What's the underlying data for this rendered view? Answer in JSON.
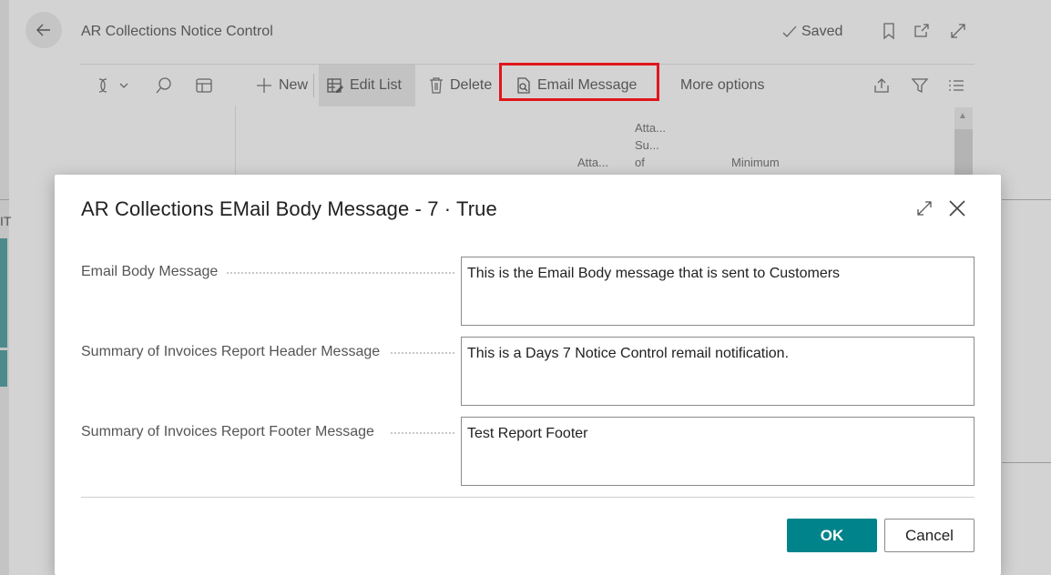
{
  "page": {
    "title": "AR Collections Notice Control",
    "saved_label": "Saved",
    "left_edge_letter": "IT"
  },
  "toolbar": {
    "new_label": "New",
    "edit_list_label": "Edit List",
    "delete_label": "Delete",
    "email_message_label": "Email Message",
    "more_options_label": "More options"
  },
  "grid": {
    "col1_header": "Atta...",
    "col2_header_lines": [
      "Atta...",
      "Su...",
      "of"
    ],
    "col3_header": "Minimum"
  },
  "modal": {
    "title": "AR Collections EMail Body Message - 7 · True",
    "fields": [
      {
        "label": "Email Body Message",
        "value": "This is the Email Body message that is sent to Customers"
      },
      {
        "label": "Summary of Invoices Report Header Message",
        "value": "This is a Days 7 Notice Control remail notification."
      },
      {
        "label": "Summary of Invoices Report Footer Message",
        "value": "Test Report Footer"
      }
    ],
    "ok_label": "OK",
    "cancel_label": "Cancel"
  },
  "colors": {
    "accent": "#00838a",
    "highlight": "#e0151b"
  }
}
